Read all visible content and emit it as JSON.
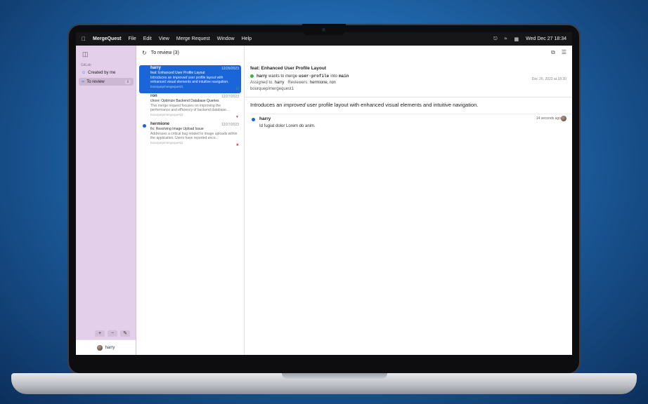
{
  "menubar": {
    "app_name": "MergeQuest",
    "menus": [
      "File",
      "Edit",
      "View",
      "Merge Request",
      "Window",
      "Help"
    ],
    "datetime": "Wed Dec 27  18:34"
  },
  "sidebar": {
    "section_label": "GitLab",
    "items": [
      {
        "label": "Created by me",
        "icon": "person-icon"
      },
      {
        "label": "To review",
        "icon": "glasses-icon"
      }
    ],
    "user": "harry"
  },
  "list": {
    "title": "To review (3)",
    "items": [
      {
        "author": "harry",
        "date": "12/26/2023",
        "title": "feat: Enhanced User Profile Layout",
        "desc_pre": "Introduces an ",
        "desc_em": "improved",
        "desc_post": " user profile layout with enhanced visual elements and intuitive navigation.",
        "repo": "bourquep/mergequest1",
        "status": "check"
      },
      {
        "author": "ron",
        "date": "12/27/2023",
        "title": "chore: Optimize Backend Database Queries",
        "desc": "This merge request focuses on improving the performance and efficiency of backend database...",
        "repo": "bourquep/mergequest3",
        "status": "thumbs-down"
      },
      {
        "author": "hermione",
        "date": "12/27/2023",
        "title": "fix: Resolving Image Upload Issue",
        "desc": "Addresses a critical bug related to image uploads within the application. Users have reported enco...",
        "repo": "bourquep/mergequest1",
        "status": "x-mark"
      }
    ]
  },
  "detail": {
    "title": "feat: Enhanced User Profile Layout",
    "merge_author": "harry",
    "merge_text": "wants to merge",
    "source_branch": "user-profile",
    "into_text": "into",
    "target_branch": "main",
    "assigned_label": "Assigned to:",
    "assignee": "harry",
    "reviewers_label": "Reviewers:",
    "reviewers": "hermione, ron",
    "repo": "bourquep/mergequest1",
    "date": "Dec 26, 2023 at 18:30",
    "body_pre": "Introduces an ",
    "body_em": "improved",
    "body_post": " user profile layout with enhanced visual elements and intuitive navigation.",
    "comment": {
      "author": "harry",
      "time": "14 seconds ago",
      "text": "Id fugiat dolor Lorem do anim."
    }
  }
}
